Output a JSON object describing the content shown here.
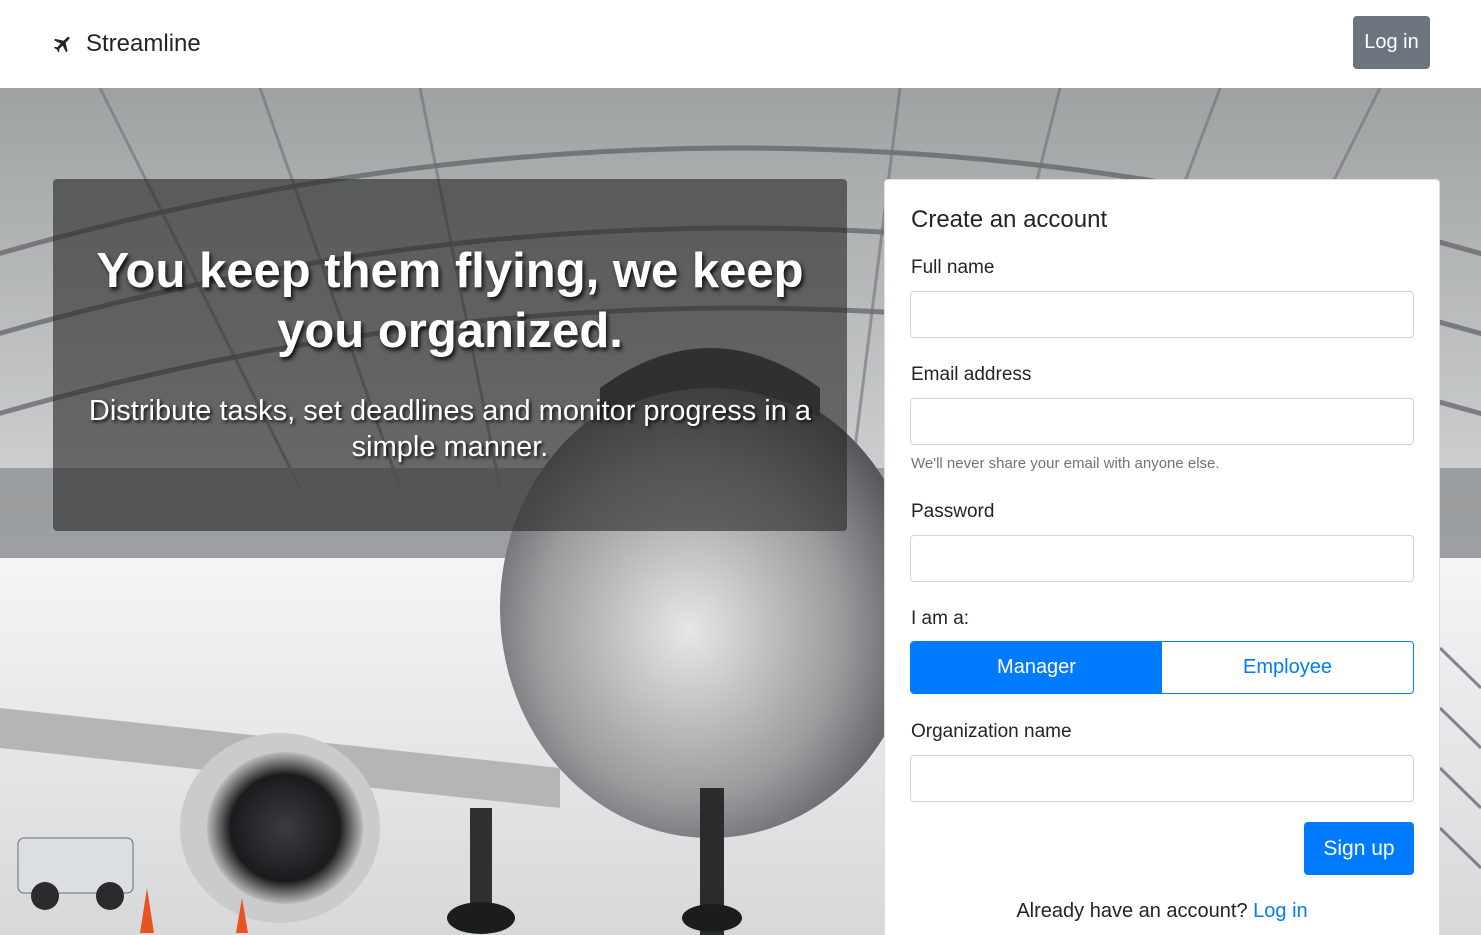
{
  "navbar": {
    "brand": "Streamline",
    "brand_icon": "plane-icon",
    "login_label": "Log in"
  },
  "hero": {
    "title": "You keep them flying, we keep you organized.",
    "subtitle": "Distribute tasks, set deadlines and monitor progress in a simple manner."
  },
  "signup": {
    "heading": "Create an account",
    "full_name_label": "Full name",
    "full_name_value": "",
    "email_label": "Email address",
    "email_value": "",
    "email_help": "We'll never share your email with anyone else.",
    "password_label": "Password",
    "password_value": "",
    "role_label": "I am a:",
    "role_options": [
      "Manager",
      "Employee"
    ],
    "role_selected": "Manager",
    "organization_label": "Organization name",
    "organization_value": "",
    "submit_label": "Sign up",
    "already_text": "Already have an account?",
    "already_link": "Log in"
  },
  "colors": {
    "primary": "#007bff",
    "secondary": "#6c757d",
    "text": "#212529",
    "muted": "#6c757d"
  }
}
